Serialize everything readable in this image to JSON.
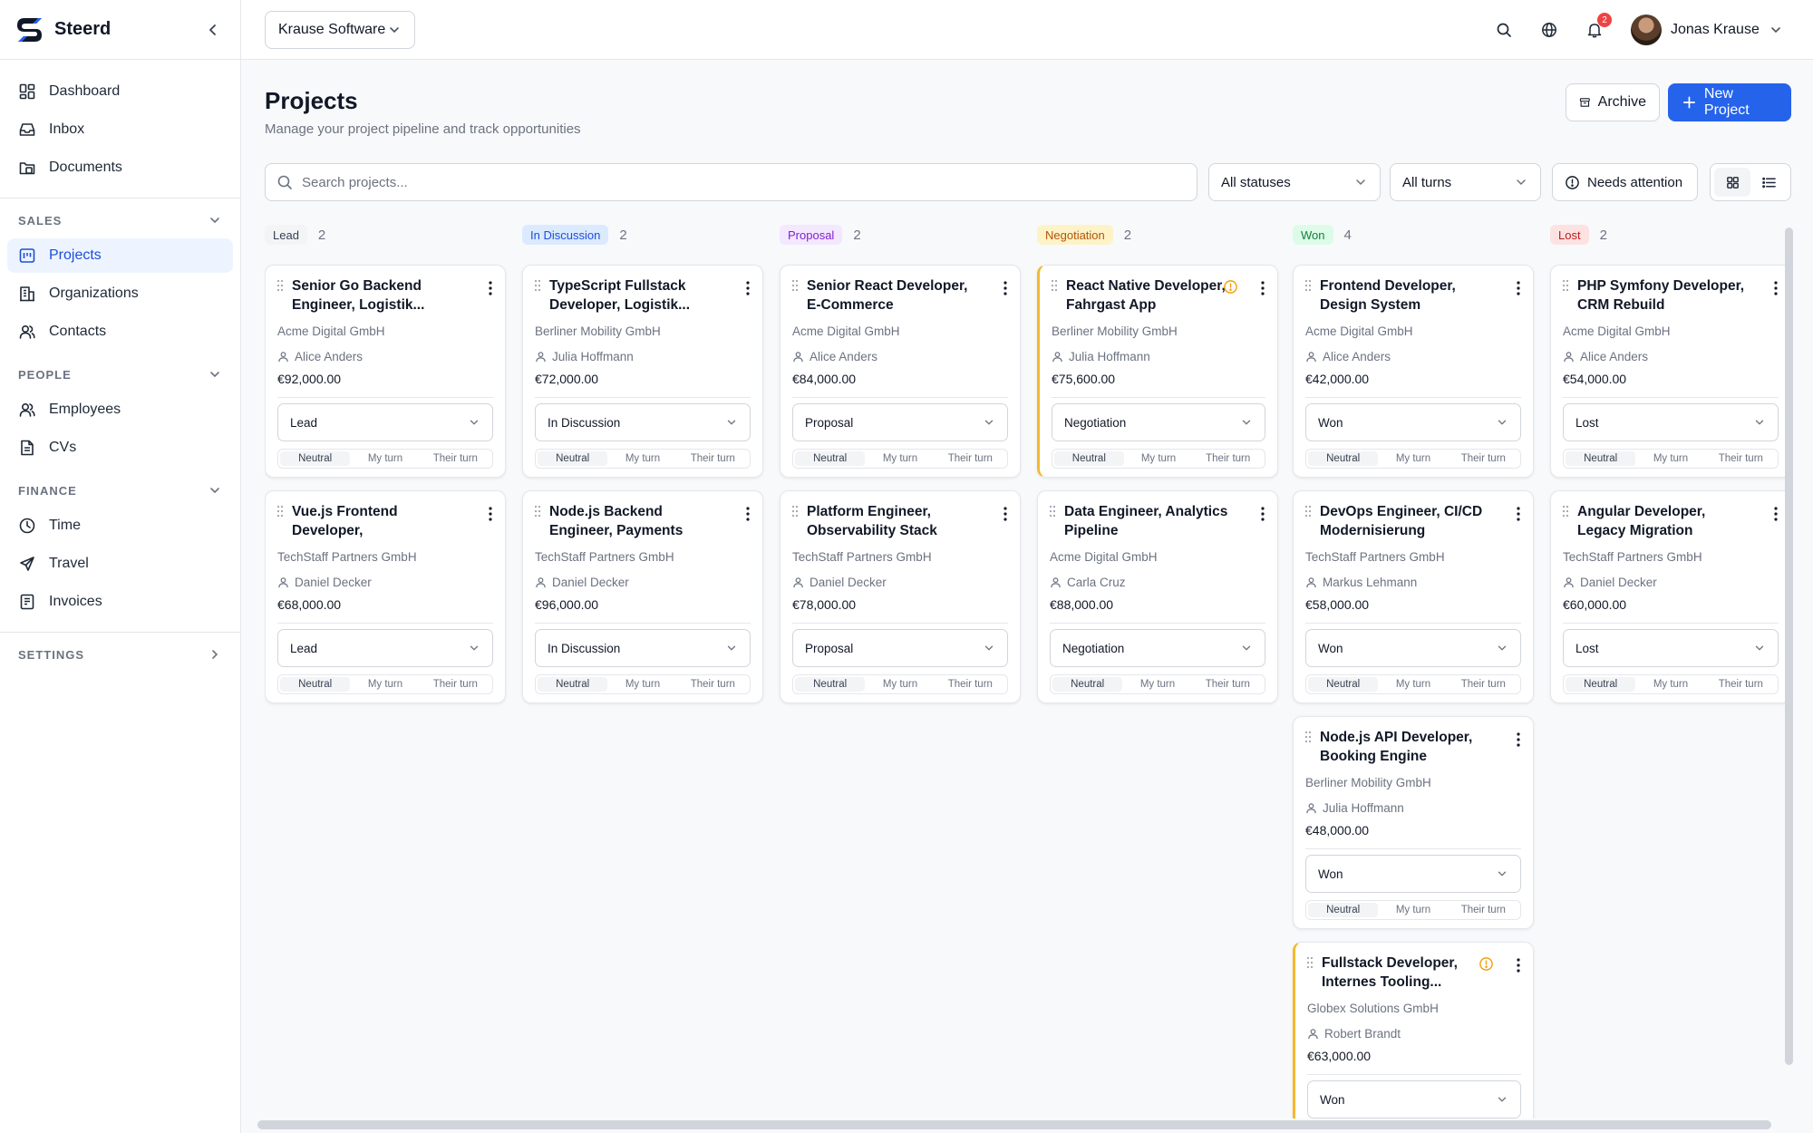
{
  "app": {
    "name": "Steerd"
  },
  "sidebar": {
    "nav": [
      {
        "label": "Dashboard",
        "icon": "dashboard-icon"
      },
      {
        "label": "Inbox",
        "icon": "inbox-icon"
      },
      {
        "label": "Documents",
        "icon": "documents-icon"
      }
    ],
    "sections": {
      "sales": {
        "title": "SALES",
        "items": [
          {
            "label": "Projects",
            "icon": "projects-icon",
            "active": true
          },
          {
            "label": "Organizations",
            "icon": "organizations-icon"
          },
          {
            "label": "Contacts",
            "icon": "contacts-icon"
          }
        ]
      },
      "people": {
        "title": "PEOPLE",
        "items": [
          {
            "label": "Employees",
            "icon": "employees-icon"
          },
          {
            "label": "CVs",
            "icon": "cv-icon"
          }
        ]
      },
      "finance": {
        "title": "FINANCE",
        "items": [
          {
            "label": "Time",
            "icon": "clock-icon"
          },
          {
            "label": "Travel",
            "icon": "plane-icon"
          },
          {
            "label": "Invoices",
            "icon": "invoice-icon"
          }
        ]
      },
      "settings": {
        "title": "SETTINGS"
      }
    }
  },
  "topbar": {
    "organization": "Krause Software",
    "notifications": "2",
    "user_name": "Jonas Krause"
  },
  "page": {
    "title": "Projects",
    "subtitle": "Manage your project pipeline and track opportunities",
    "archive_label": "Archive",
    "new_label": "New Project"
  },
  "filters": {
    "search_placeholder": "Search projects...",
    "status": "All statuses",
    "turn": "All turns",
    "attention_label": "Needs attention"
  },
  "turn_options": [
    "Neutral",
    "My turn",
    "Their turn"
  ],
  "colors": {
    "accent": "#2563eb",
    "lead": "#f3f4f6",
    "in_discussion": "#dbeafe",
    "proposal": "#f3e8ff",
    "negotiation": "#fef3c7",
    "won": "#dcfce7",
    "lost": "#fee2e2",
    "attention": "#f5b82e"
  },
  "columns": [
    {
      "label": "Lead",
      "count": "2",
      "cards": [
        {
          "title": "Senior Go Backend Engineer, Logistik...",
          "org": "Acme Digital GmbH",
          "person": "Alice Anders",
          "amount": "€92,000.00",
          "stage": "Lead",
          "turn": "Neutral"
        },
        {
          "title": "Vue.js Frontend Developer, Versicherungsportal",
          "org": "TechStaff Partners GmbH",
          "person": "Daniel Decker",
          "amount": "€68,000.00",
          "stage": "Lead",
          "turn": "Neutral"
        }
      ]
    },
    {
      "label": "In Discussion",
      "count": "2",
      "cards": [
        {
          "title": "TypeScript Fullstack Developer, Logistik...",
          "org": "Berliner Mobility GmbH",
          "person": "Julia Hoffmann",
          "amount": "€72,000.00",
          "stage": "In Discussion",
          "turn": "Neutral"
        },
        {
          "title": "Node.js Backend Engineer, Payments Plattform",
          "org": "TechStaff Partners GmbH",
          "person": "Daniel Decker",
          "amount": "€96,000.00",
          "stage": "In Discussion",
          "turn": "Neutral"
        }
      ]
    },
    {
      "label": "Proposal",
      "count": "2",
      "cards": [
        {
          "title": "Senior React Developer, E-Commerce Replatforming",
          "org": "Acme Digital GmbH",
          "person": "Alice Anders",
          "amount": "€84,000.00",
          "stage": "Proposal",
          "turn": "Neutral"
        },
        {
          "title": "Platform Engineer, Observability Stack",
          "org": "TechStaff Partners GmbH",
          "person": "Daniel Decker",
          "amount": "€78,000.00",
          "stage": "Proposal",
          "turn": "Neutral"
        }
      ]
    },
    {
      "label": "Negotiation",
      "count": "2",
      "cards": [
        {
          "title": "React Native Developer, Fahrgast App",
          "org": "Berliner Mobility GmbH",
          "person": "Julia Hoffmann",
          "amount": "€75,600.00",
          "stage": "Negotiation",
          "turn": "Neutral",
          "attention": true
        },
        {
          "title": "Data Engineer, Analytics Pipeline",
          "org": "Acme Digital GmbH",
          "person": "Carla Cruz",
          "amount": "€88,000.00",
          "stage": "Negotiation",
          "turn": "Neutral"
        }
      ]
    },
    {
      "label": "Won",
      "count": "4",
      "cards": [
        {
          "title": "Frontend Developer, Design System",
          "org": "Acme Digital GmbH",
          "person": "Alice Anders",
          "amount": "€42,000.00",
          "stage": "Won",
          "turn": "Neutral"
        },
        {
          "title": "DevOps Engineer, CI/CD Modernisierung",
          "org": "TechStaff Partners GmbH",
          "person": "Markus Lehmann",
          "amount": "€58,000.00",
          "stage": "Won",
          "turn": "Neutral"
        },
        {
          "title": "Node.js API Developer, Booking Engine",
          "org": "Berliner Mobility GmbH",
          "person": "Julia Hoffmann",
          "amount": "€48,000.00",
          "stage": "Won",
          "turn": "Neutral"
        },
        {
          "title": "Fullstack Developer, Internes Tooling...",
          "org": "Globex Solutions GmbH",
          "person": "Robert Brandt",
          "amount": "€63,000.00",
          "stage": "Won",
          "turn": "Neutral",
          "attention": true
        }
      ]
    },
    {
      "label": "Lost",
      "count": "2",
      "cards": [
        {
          "title": "PHP Symfony Developer, CRM Rebuild",
          "org": "Acme Digital GmbH",
          "person": "Alice Anders",
          "amount": "€54,000.00",
          "stage": "Lost",
          "turn": "Neutral"
        },
        {
          "title": "Angular Developer, Legacy Migration",
          "org": "TechStaff Partners GmbH",
          "person": "Daniel Decker",
          "amount": "€60,000.00",
          "stage": "Lost",
          "turn": "Neutral"
        }
      ]
    }
  ]
}
